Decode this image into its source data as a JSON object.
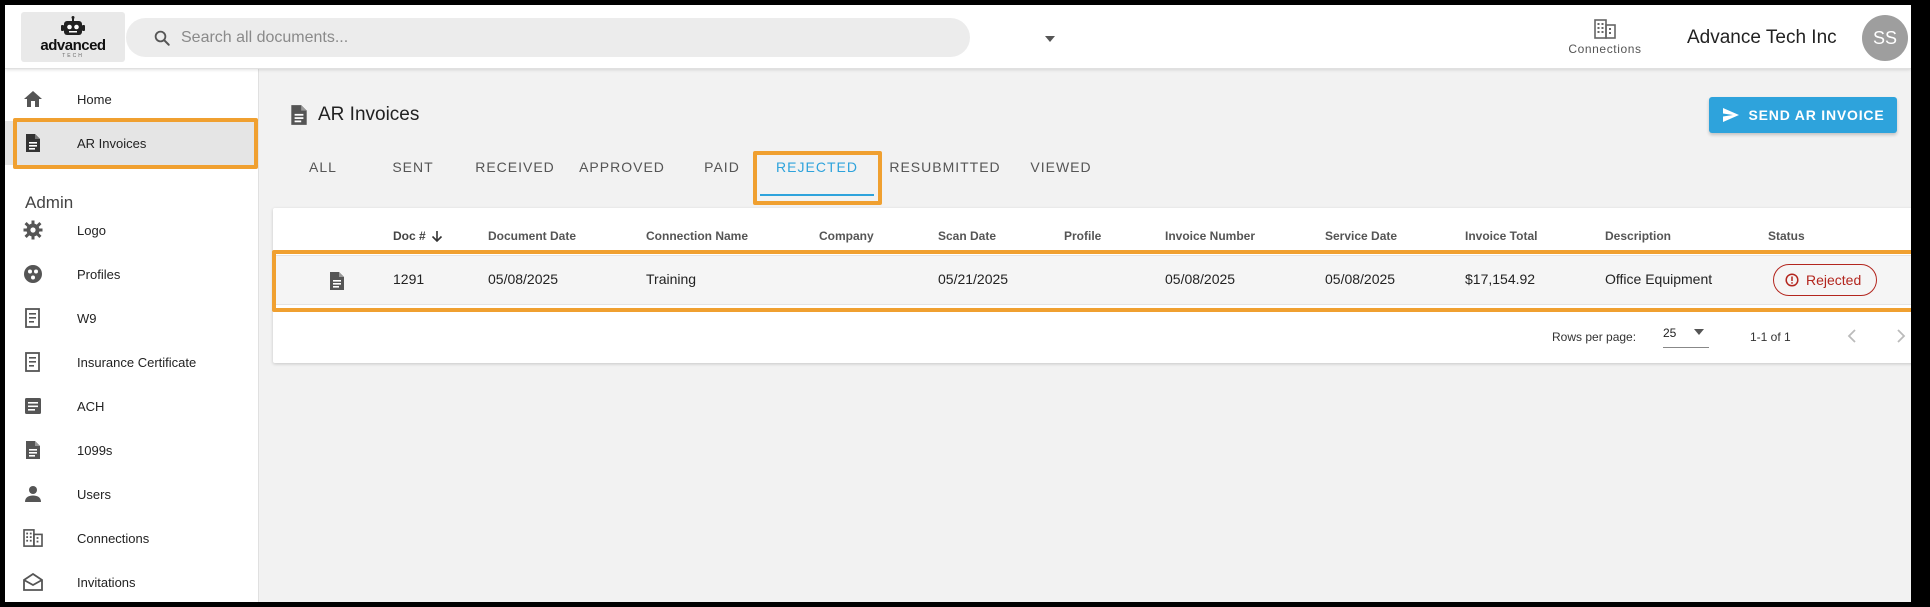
{
  "header": {
    "logo_text": "advanced",
    "logo_sub": "TECH",
    "search_placeholder": "Search all documents...",
    "connections_label": "Connections",
    "company_name": "Advance Tech Inc",
    "avatar_initials": "SS"
  },
  "sidebar": {
    "items": [
      {
        "label": "Home",
        "icon": "home-icon"
      },
      {
        "label": "AR Invoices",
        "icon": "document-icon"
      }
    ],
    "admin_heading": "Admin",
    "admin_items": [
      {
        "label": "Logo",
        "icon": "gear-icon"
      },
      {
        "label": "Profiles",
        "icon": "profiles-icon"
      },
      {
        "label": "W9",
        "icon": "receipt-icon"
      },
      {
        "label": "Insurance Certificate",
        "icon": "receipt-icon"
      },
      {
        "label": "ACH",
        "icon": "article-icon"
      },
      {
        "label": "1099s",
        "icon": "document-icon"
      },
      {
        "label": "Users",
        "icon": "person-icon"
      },
      {
        "label": "Connections",
        "icon": "building-icon"
      },
      {
        "label": "Invitations",
        "icon": "envelope-icon"
      }
    ]
  },
  "main": {
    "title": "AR Invoices",
    "send_button_label": "SEND AR INVOICE",
    "tabs": [
      {
        "label": "ALL"
      },
      {
        "label": "SENT"
      },
      {
        "label": "RECEIVED"
      },
      {
        "label": "APPROVED"
      },
      {
        "label": "PAID"
      },
      {
        "label": "REJECTED"
      },
      {
        "label": "RESUBMITTED"
      },
      {
        "label": "VIEWED"
      }
    ],
    "active_tab": "REJECTED",
    "table": {
      "columns": [
        "Doc #",
        "Document Date",
        "Connection Name",
        "Company",
        "Scan Date",
        "Profile",
        "Invoice Number",
        "Service Date",
        "Invoice Total",
        "Description",
        "Status"
      ],
      "rows": [
        {
          "doc_no": "1291",
          "document_date": "05/08/2025",
          "connection_name": "Training",
          "company": "",
          "scan_date": "05/21/2025",
          "profile": "",
          "invoice_number": "05/08/2025",
          "service_date": "05/08/2025",
          "invoice_total": "$17,154.92",
          "description": "Office Equipment",
          "status": "Rejected"
        }
      ]
    },
    "pagination": {
      "rows_per_page_label": "Rows per page:",
      "rows_per_page_value": "25",
      "range_text": "1-1 of 1"
    }
  },
  "colors": {
    "accent": "#2ea3dc",
    "highlight": "#f0a030",
    "rejected": "#b3261e"
  }
}
